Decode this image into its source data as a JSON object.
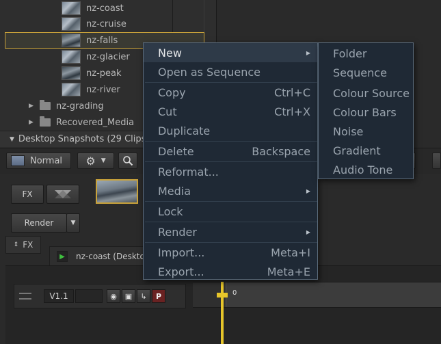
{
  "tree": {
    "clips": [
      {
        "label": "nz-coast"
      },
      {
        "label": "nz-cruise"
      },
      {
        "label": "nz-falls"
      },
      {
        "label": "nz-glacier"
      },
      {
        "label": "nz-peak"
      },
      {
        "label": "nz-river"
      }
    ],
    "folders": [
      {
        "label": "nz-grading"
      },
      {
        "label": "Recovered_Media"
      }
    ],
    "snapshots_label": "Desktop Snapshots (29 Clips)"
  },
  "toolbar": {
    "mode": "Normal"
  },
  "panel": {
    "fx_button": "FX",
    "render_button": "Render",
    "fx_tab": "FX",
    "sequence_tab": "nz-coast (Deskto"
  },
  "timeline": {
    "track_name": "V1.1",
    "p_button": "P",
    "clip_frame": "0"
  },
  "context_menu": {
    "items": [
      {
        "label": "New",
        "shortcut": ""
      },
      {
        "label": "Open as Sequence",
        "shortcut": ""
      },
      {
        "label": "Copy",
        "shortcut": "Ctrl+C"
      },
      {
        "label": "Cut",
        "shortcut": "Ctrl+X"
      },
      {
        "label": "Duplicate",
        "shortcut": ""
      },
      {
        "label": "Delete",
        "shortcut": "Backspace"
      },
      {
        "label": "Reformat...",
        "shortcut": ""
      },
      {
        "label": "Media",
        "shortcut": ""
      },
      {
        "label": "Lock",
        "shortcut": ""
      },
      {
        "label": "Render",
        "shortcut": ""
      },
      {
        "label": "Import...",
        "shortcut": "Meta+I"
      },
      {
        "label": "Export...",
        "shortcut": "Meta+E"
      }
    ]
  },
  "submenu": {
    "items": [
      {
        "label": "Folder"
      },
      {
        "label": "Sequence"
      },
      {
        "label": "Colour Source"
      },
      {
        "label": "Colour Bars"
      },
      {
        "label": "Noise"
      },
      {
        "label": "Gradient"
      },
      {
        "label": "Audio Tone"
      }
    ]
  },
  "colors": {
    "accent": "#c9a23a",
    "playhead": "#e6c52a",
    "menu_bg": "#1f2935"
  }
}
